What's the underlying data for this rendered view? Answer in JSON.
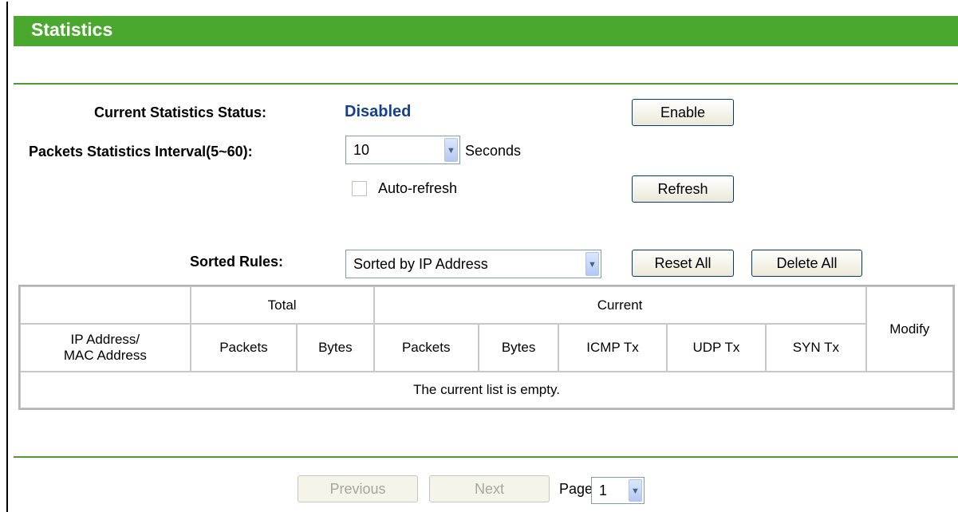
{
  "header": {
    "title": "Statistics"
  },
  "status": {
    "label": "Current Statistics Status:",
    "value": "Disabled",
    "enable_button": "Enable"
  },
  "interval": {
    "label": "Packets Statistics Interval(5~60):",
    "value": "10",
    "unit": "Seconds"
  },
  "autorefresh": {
    "label": "Auto-refresh",
    "checked": false
  },
  "refresh_button": "Refresh",
  "sorted_rules": {
    "label": "Sorted Rules:",
    "value": "Sorted by IP Address",
    "reset_all": "Reset All",
    "delete_all": "Delete All"
  },
  "table": {
    "group_total": "Total",
    "group_current": "Current",
    "modify": "Modify",
    "col_address_line1": "IP Address/",
    "col_address_line2": "MAC Address",
    "columns": [
      "Packets",
      "Bytes",
      "Packets",
      "Bytes",
      "ICMP Tx",
      "UDP Tx",
      "SYN Tx"
    ],
    "empty_message": "The current list is empty."
  },
  "pagination": {
    "previous": "Previous",
    "next": "Next",
    "page_label": "Page",
    "page_value": "1"
  }
}
